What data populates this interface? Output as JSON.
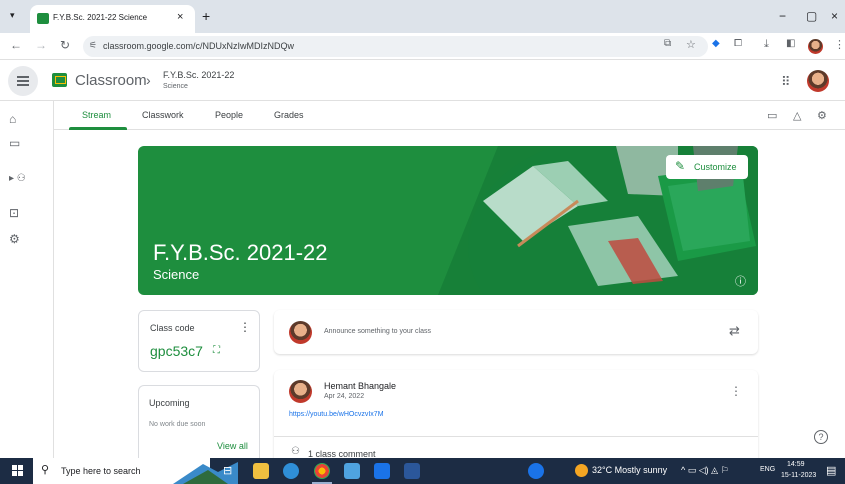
{
  "browser": {
    "tab_title": "F.Y.B.Sc. 2021-22 Science",
    "tab_close": "×",
    "new_tab": "+",
    "url": "classroom.google.com/c/NDUxNzIwMDIzNDQw",
    "window": {
      "minimize": "−",
      "maximize": "▢",
      "close": "×"
    }
  },
  "header": {
    "app_name": "Classroom",
    "class_name": "F.Y.B.Sc. 2021-22",
    "class_section": "Science"
  },
  "tabs": [
    "Stream",
    "Classwork",
    "People",
    "Grades"
  ],
  "banner": {
    "title": "F.Y.B.Sc. 2021-22",
    "subtitle": "Science",
    "customize_label": "Customize",
    "color": "#1e8e3e"
  },
  "class_code": {
    "label": "Class code",
    "value": "gpc53c7"
  },
  "upcoming": {
    "label": "Upcoming",
    "empty_text": "No work due soon",
    "view_all": "View all"
  },
  "announce": {
    "placeholder": "Announce something to your class"
  },
  "post": {
    "author": "Hemant Bhangale",
    "date": "Apr 24, 2022",
    "link": "https://youtu.be/wHOcvzvIx7M",
    "comments": "1 class comment"
  },
  "taskbar": {
    "search_placeholder": "Type here to search",
    "weather": "32°C  Mostly sunny",
    "language": "ENG",
    "time": "14:59",
    "date": "15-11-2023"
  },
  "colors": {
    "accent": "#1e8e3e",
    "taskbar": "#1c2c44"
  }
}
